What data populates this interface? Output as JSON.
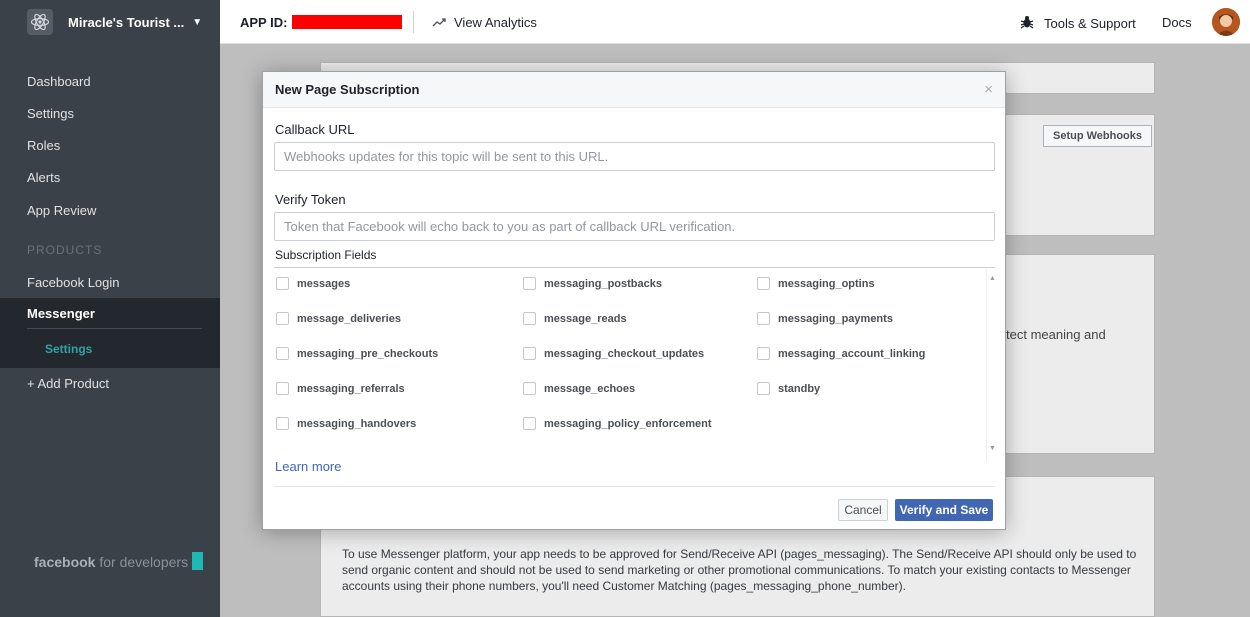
{
  "topbar": {
    "app_name": "Miracle's Tourist ...",
    "app_id_label": "APP ID:",
    "app_id_value": "redacted",
    "view_analytics": "View Analytics",
    "tools_support": "Tools & Support",
    "docs": "Docs"
  },
  "sidebar": {
    "items": [
      "Dashboard",
      "Settings",
      "Roles",
      "Alerts",
      "App Review"
    ],
    "products_header": "PRODUCTS",
    "facebook_login": "Facebook Login",
    "messenger": "Messenger",
    "messenger_settings": "Settings",
    "add_product": "+ Add Product",
    "footer_brand": "facebook",
    "footer_suffix": "for developers"
  },
  "background": {
    "setup_webhooks": "Setup Webhooks",
    "partial_text": "tect meaning and",
    "paragraph": "To use Messenger platform, your app needs to be approved for Send/Receive API (pages_messaging). The Send/Receive API should only be used to send organic content and should not be used to send marketing or other promotional communications. To match your existing contacts to Messenger accounts using their phone numbers, you'll need Customer Matching (pages_messaging_phone_number)."
  },
  "modal": {
    "title": "New Page Subscription",
    "close": "×",
    "callback_label": "Callback URL",
    "callback_placeholder": "Webhooks updates for this topic will be sent to this URL.",
    "verify_label": "Verify Token",
    "verify_placeholder": "Token that Facebook will echo back to you as part of callback URL verification.",
    "fields_label": "Subscription Fields",
    "fields": [
      "messages",
      "messaging_postbacks",
      "messaging_optins",
      "message_deliveries",
      "message_reads",
      "messaging_payments",
      "messaging_pre_checkouts",
      "messaging_checkout_updates",
      "messaging_account_linking",
      "messaging_referrals",
      "message_echoes",
      "standby",
      "messaging_handovers",
      "messaging_policy_enforcement"
    ],
    "learn_more": "Learn more",
    "cancel": "Cancel",
    "verify_save": "Verify and Save"
  },
  "colors": {
    "sidebar_bg": "#3b4148",
    "accent_teal": "#2ea3a0",
    "primary_blue": "#4267b2",
    "redaction": "#ff0000"
  }
}
